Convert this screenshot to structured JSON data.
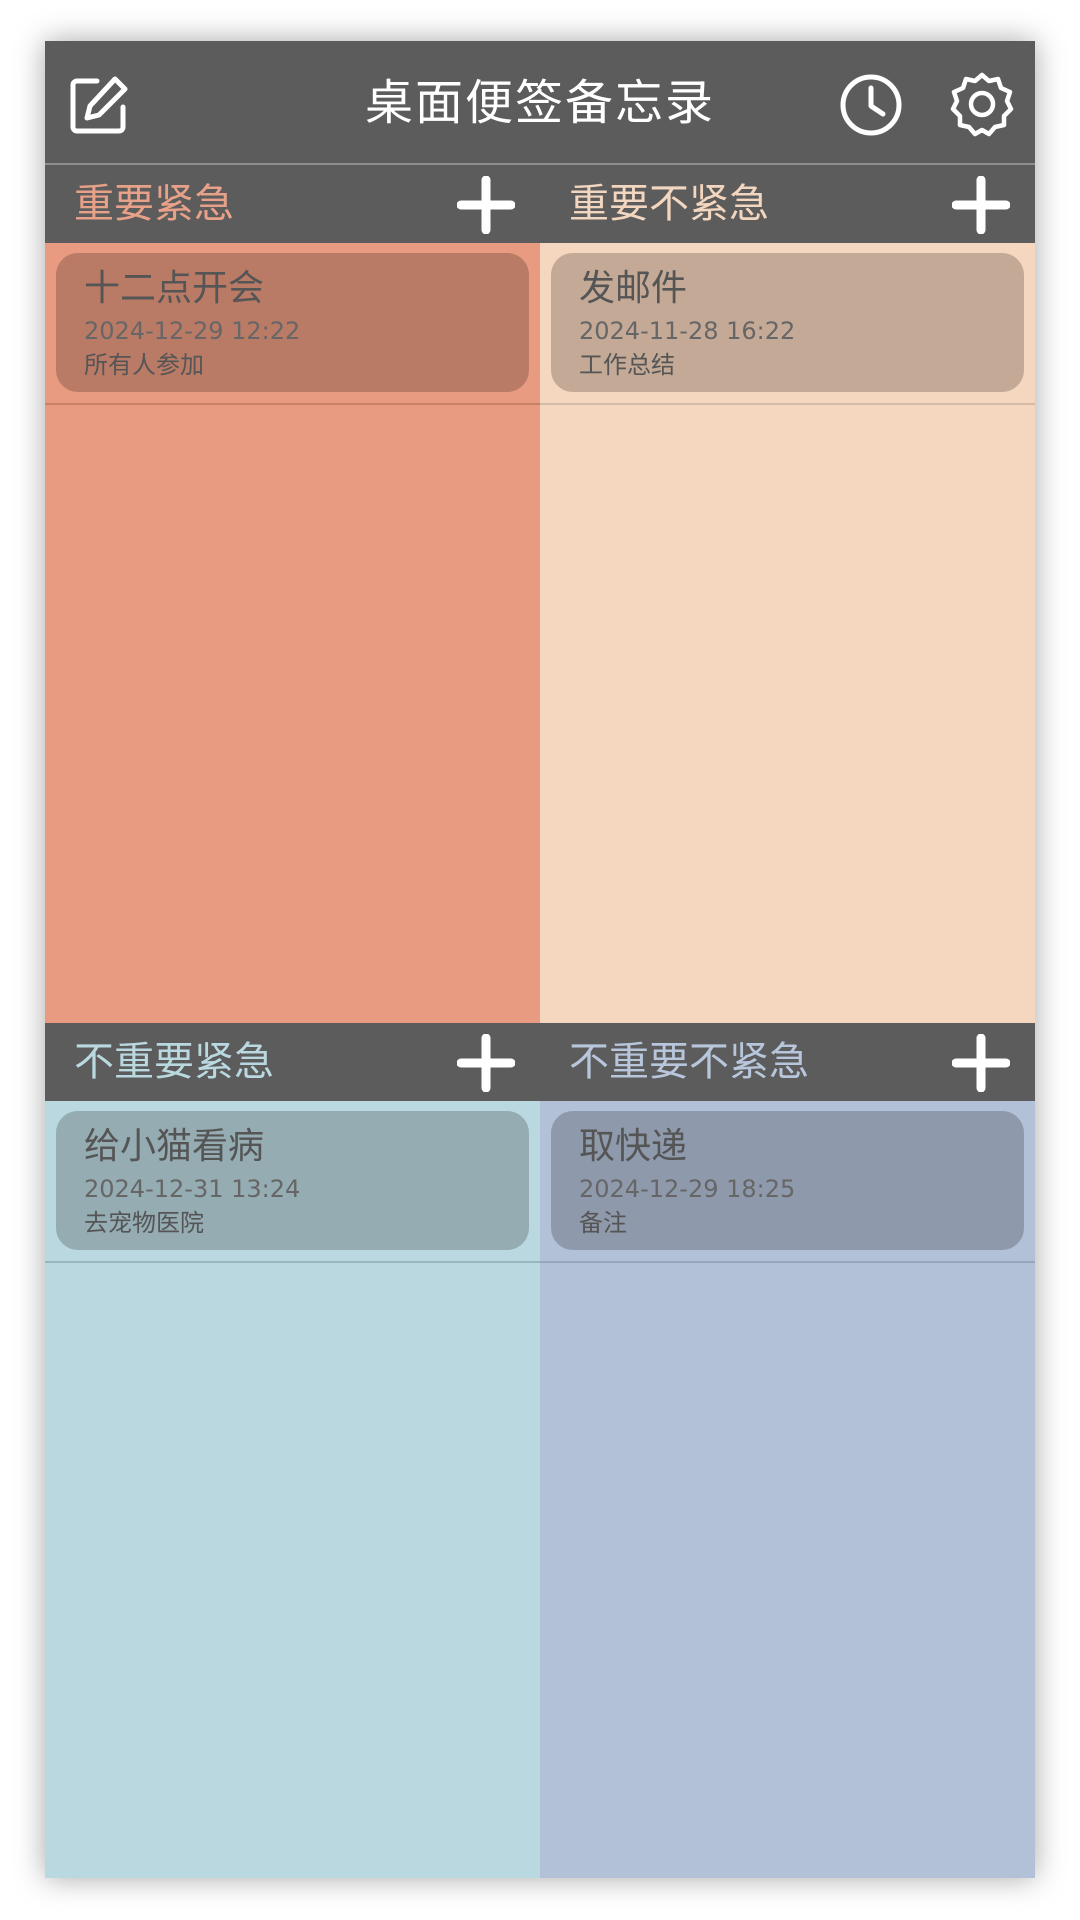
{
  "header": {
    "title": "桌面便签备忘录",
    "icons": {
      "edit": "edit-icon",
      "history": "clock-icon",
      "settings": "gear-icon"
    }
  },
  "quadrants": [
    {
      "title": "重要紧急",
      "color": "#e89b80",
      "add_icon": "plus-icon",
      "notes": [
        {
          "title": "十二点开会",
          "datetime": "2024-12-29 12:22",
          "remark": "所有人参加"
        }
      ]
    },
    {
      "title": "重要不紧急",
      "color": "#f5d7bf",
      "add_icon": "plus-icon",
      "notes": [
        {
          "title": "发邮件",
          "datetime": "2024-11-28 16:22",
          "remark": "工作总结"
        }
      ]
    },
    {
      "title": "不重要紧急",
      "color": "#b9d8e0",
      "add_icon": "plus-icon",
      "notes": [
        {
          "title": "给小猫看病",
          "datetime": "2024-12-31 13:24",
          "remark": "去宠物医院"
        }
      ]
    },
    {
      "title": "不重要不紧急",
      "color": "#b2c1d8",
      "add_icon": "plus-icon",
      "notes": [
        {
          "title": "取快递",
          "datetime": "2024-12-29 18:25",
          "remark": "备注"
        }
      ]
    }
  ]
}
